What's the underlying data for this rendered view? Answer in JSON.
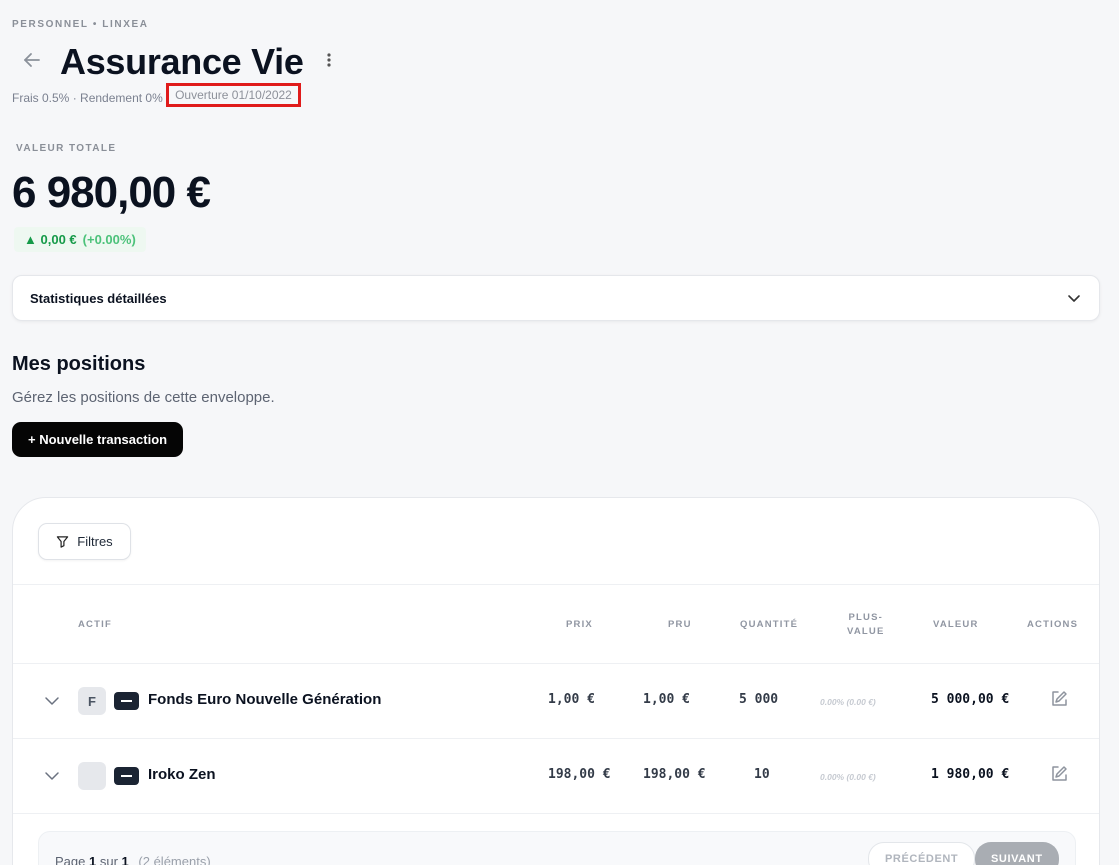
{
  "breadcrumb": "PERSONNEL • LINXEA",
  "title": "Assurance Vie",
  "meta": {
    "frais": "Frais 0.5%",
    "sep": " · ",
    "rendement": "Rendement 0%",
    "ouverture": "Ouverture 01/10/2022"
  },
  "valeur": {
    "label": "VALEUR TOTALE",
    "amount": "6 980,00 €",
    "delta_value": "0,00 €",
    "delta_pct": "(+0.00%)"
  },
  "stats": {
    "label": "Statistiques détaillées"
  },
  "positions": {
    "title": "Mes positions",
    "subtitle": "Gérez les positions de cette enveloppe.",
    "new_tx": "+ Nouvelle transaction",
    "filters": "Filtres"
  },
  "columns": {
    "actif": "ACTIF",
    "prix": "PRIX",
    "pru": "PRU",
    "quantite": "QUANTITÉ",
    "plus_value_1": "PLUS-",
    "plus_value_2": "VALUE",
    "valeur": "VALEUR",
    "actions": "ACTIONS"
  },
  "rows": [
    {
      "logo": "F",
      "name": "Fonds Euro Nouvelle Génération",
      "prix": "1,00 €",
      "pru": "1,00 €",
      "quantite": "5 000",
      "plus_value": "0.00% (0.00 €)",
      "valeur": "5 000,00 €"
    },
    {
      "logo": "",
      "name": "Iroko Zen",
      "prix": "198,00 €",
      "pru": "198,00 €",
      "quantite": "10",
      "plus_value": "0.00% (0.00 €)",
      "valeur": "1 980,00 €"
    }
  ],
  "pager": {
    "page_word": "Page",
    "current": "1",
    "sur": "sur",
    "total": "1",
    "count": "(2 éléments)",
    "prev": "PRÉCÉDENT",
    "next": "SUIVANT"
  },
  "colors": {
    "accent": "#050505",
    "positive": "#159a48",
    "highlight": "#e01b1b"
  }
}
